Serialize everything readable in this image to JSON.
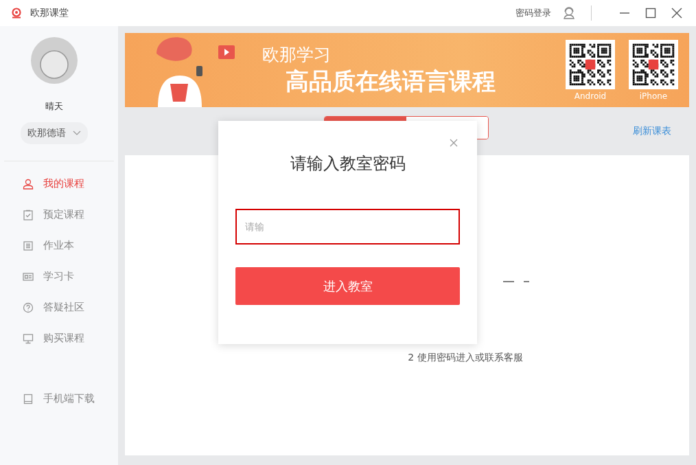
{
  "window": {
    "title": "欧那课堂"
  },
  "titlebar": {
    "login_link": "密码登录"
  },
  "sidebar": {
    "user_name": "晴天",
    "language_select": "欧那德语",
    "items": [
      {
        "label": "我的课程",
        "kind": "user",
        "selected": true
      },
      {
        "label": "预定课程",
        "kind": "clipboard",
        "selected": false
      },
      {
        "label": "作业本",
        "kind": "list",
        "selected": false
      },
      {
        "label": "学习卡",
        "kind": "card",
        "selected": false
      },
      {
        "label": "答疑社区",
        "kind": "question",
        "selected": false
      },
      {
        "label": "购买课程",
        "kind": "monitor",
        "selected": false
      }
    ],
    "download": {
      "label": "手机端下载",
      "kind": "tablet"
    }
  },
  "banner": {
    "brand": "欧那学习",
    "headline": "高品质在线语言课程",
    "qr_codes": [
      {
        "label": "Android"
      },
      {
        "label": "iPhone"
      }
    ]
  },
  "course_tabs": [
    {
      "selected": true
    },
    {
      "selected": false
    }
  ],
  "refresh_link": "刷新课表",
  "empty_state": {
    "hint": "2 使用密码进入或联系客服"
  },
  "dialog": {
    "title": "请输入教室密码",
    "input": {
      "placeholder": "请输"
    },
    "button": "进入教室"
  }
}
